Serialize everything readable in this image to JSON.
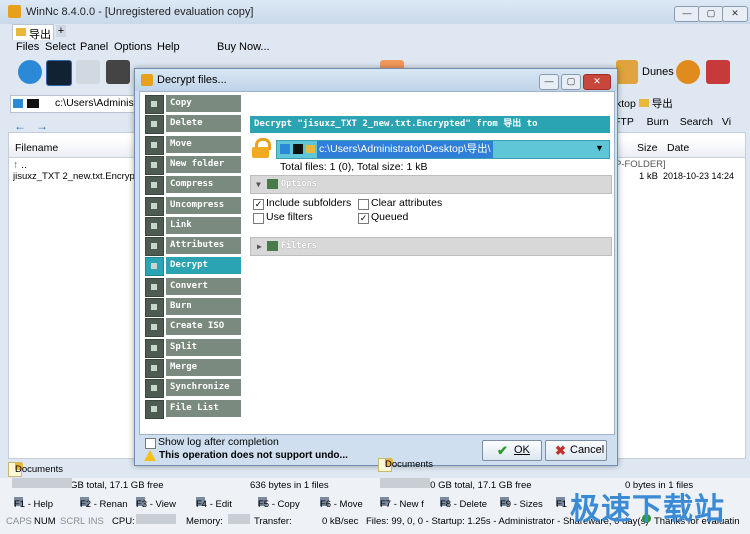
{
  "window": {
    "title": "WinNc 8.4.0.0 - [Unregistered evaluation copy]",
    "tab": "导出",
    "new_tab": "+"
  },
  "menu": [
    "Files",
    "Select",
    "Panel",
    "Options",
    "Help",
    "Buy Now..."
  ],
  "toolbar": {
    "dunes_label": "Dunes"
  },
  "left_panel": {
    "address": "c:\\Users\\Administrat",
    "header": "Filename",
    "rows": [
      "..",
      "jisuxz_TXT 2_new.txt.Encrypted"
    ],
    "doc_tab": "Documents",
    "drive": "Drive C: 40.0 GB total, 17.1 GB free",
    "file_info": "636 bytes in 1 files"
  },
  "right_panel": {
    "address_tail": "ktop",
    "address_folder": "导出",
    "tools": [
      "FTP",
      "Burn",
      "Search",
      "Vi"
    ],
    "headers": [
      "Size",
      "Date"
    ],
    "folder_row": "P-FOLDER]",
    "file_size": "1 kB",
    "file_date": "2018-10-23 14:24",
    "doc_tab": "Documents",
    "drive": "Drive C: 40.0 GB total, 17.1 GB free",
    "file_info": "0 bytes in 1 files"
  },
  "dialog": {
    "title": "Decrypt files...",
    "operations": [
      "Copy",
      "Delete",
      "Move",
      "New folder",
      "Compress",
      "Uncompress",
      "Link",
      "Attributes",
      "Decrypt",
      "Convert",
      "Burn",
      "Create ISO",
      "Split",
      "Merge",
      "Synchronize",
      "File List"
    ],
    "selected_operation": "Decrypt",
    "operation_text": "Decrypt \"jisuxz_TXT 2_new.txt.Encrypted\" from 导出 to",
    "destination": "c:\\Users\\Administrator\\Desktop\\导出\\",
    "totals": "Total files: 1 (0), Total size: 1 kB",
    "options_label": "Options",
    "filters_label": "Filters",
    "options": [
      {
        "label": "Include subfolders",
        "checked": true
      },
      {
        "label": "Clear attributes",
        "checked": false
      },
      {
        "label": "Use filters",
        "checked": false
      },
      {
        "label": "Queued",
        "checked": true
      }
    ],
    "show_log": {
      "label": "Show log after completion",
      "checked": false
    },
    "warning": "This operation does not support undo...",
    "ok_label": "OK",
    "cancel_label": "Cancel"
  },
  "fkeys": [
    "F1 - Help",
    "F2 - Renan",
    "F3 - View",
    "F4 - Edit",
    "F5 - Copy",
    "F6 - Move",
    "F7 - New f",
    "F8 - Delete",
    "F9 - Sizes",
    "F1"
  ],
  "status": {
    "keys": [
      "CAPS",
      "NUM",
      "SCRL",
      "INS"
    ],
    "cpu_label": "CPU:",
    "memory_label": "Memory:",
    "transfer_label": "Transfer:",
    "transfer_value": "0 kB/sec",
    "files_info": "Files: 99, 0, 0 - Startup: 1.25s - Administrator - Shareware, 0 day(s)",
    "thanks": "Thanks for evaluatin"
  },
  "watermark": "极速下载站",
  "colors": {
    "accent": "#2aa3b3",
    "op_gray": "#7b8a7f",
    "highlight": "#2f7fd8"
  }
}
